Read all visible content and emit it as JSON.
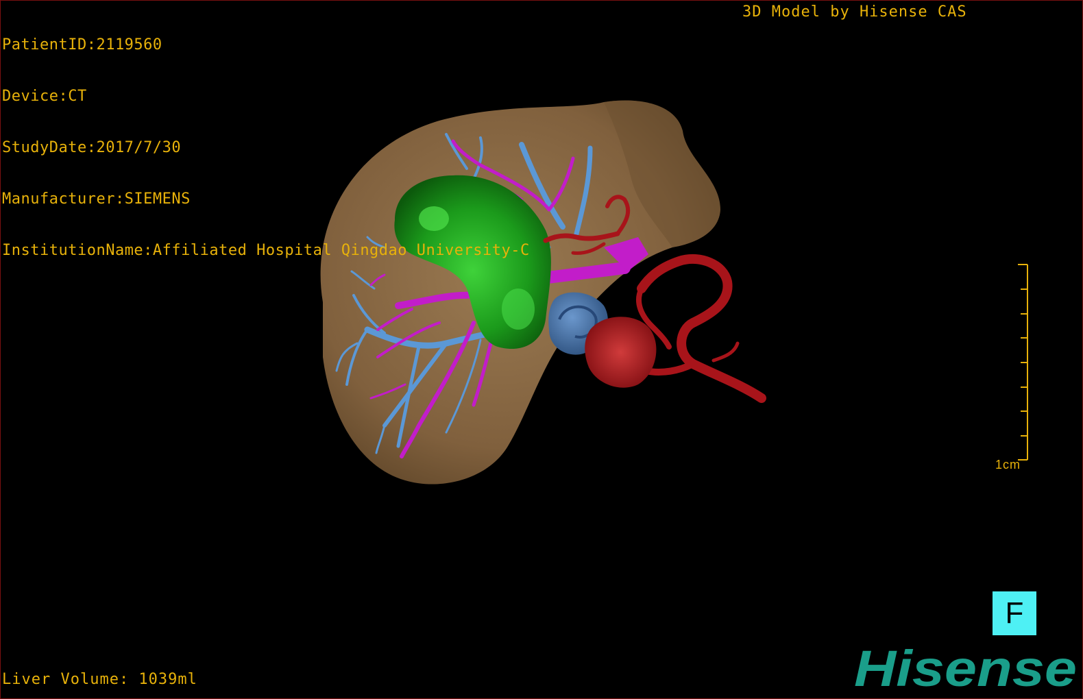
{
  "overlay": {
    "patient_id": "PatientID:2119560",
    "device": "Device:CT",
    "study_date": "StudyDate:2017/7/30",
    "manufacturer": "Manufacturer:SIEMENS",
    "institution": "InstitutionName:Affiliated Hospital Qingdao University-C",
    "model_credit": "3D Model by Hisense CAS",
    "liver_volume": "Liver Volume: 1039ml"
  },
  "scale_bar": {
    "label": "1cm"
  },
  "orientation": {
    "label": "F"
  },
  "brand": {
    "logo_text": "Hisense"
  },
  "colors": {
    "liver": "#8a6a45",
    "tumor": "#1fa21f",
    "portal_vein": "#c21dc9",
    "hepatic_vein": "#5b98d6",
    "artery": "#a8141a",
    "ivc": "#3e6ba3",
    "text": "#e8b20a",
    "logo": "#1a9e8a",
    "orientation_box": "#4ef0f4"
  }
}
